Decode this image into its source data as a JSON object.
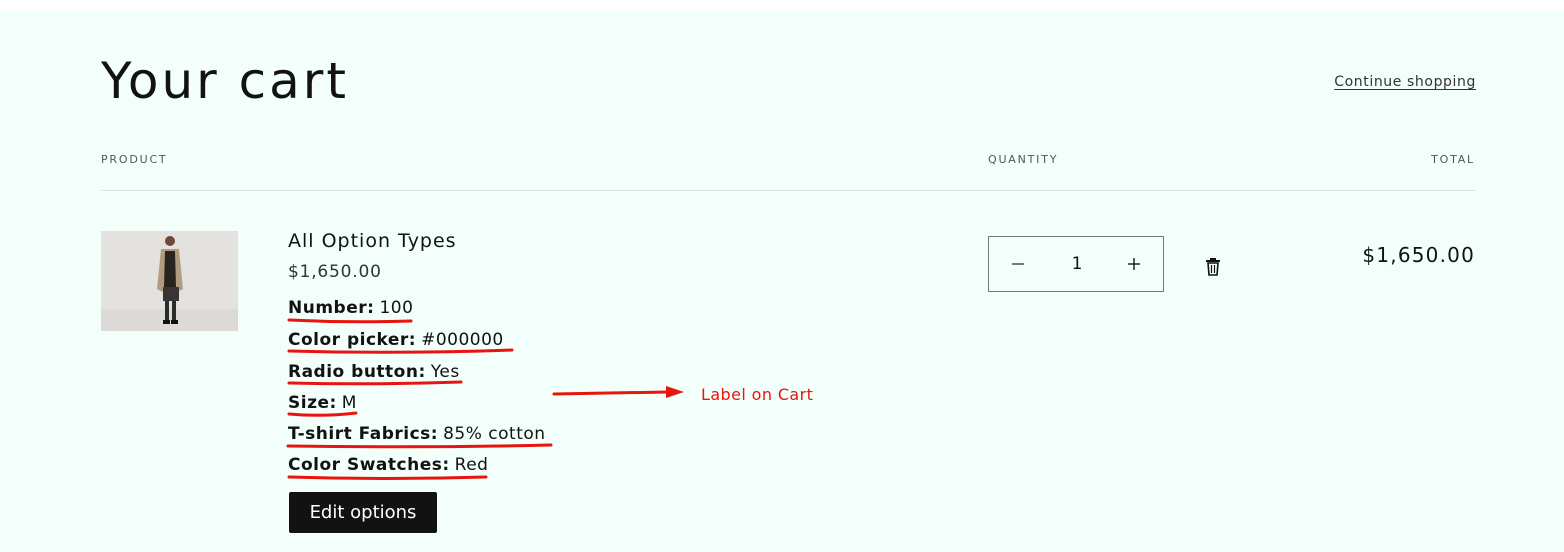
{
  "cart": {
    "title": "Your cart",
    "continue_shopping": "Continue shopping"
  },
  "columns": {
    "product": "PRODUCT",
    "quantity": "QUANTITY",
    "total": "TOTAL"
  },
  "item": {
    "name": "All Option Types",
    "price": "$1,650.00",
    "options": [
      {
        "label": "Number:",
        "value": "100"
      },
      {
        "label": "Color picker:",
        "value": "#000000"
      },
      {
        "label": "Radio button:",
        "value": "Yes"
      },
      {
        "label": "Size:",
        "value": "M"
      },
      {
        "label": "T-shirt Fabrics:",
        "value": "85% cotton"
      },
      {
        "label": "Color Swatches:",
        "value": "Red"
      }
    ],
    "edit_label": "Edit options",
    "quantity": "1",
    "line_total": "$1,650.00"
  },
  "annotation": {
    "text": "Label on Cart",
    "color": "#e8150f"
  },
  "icons": {
    "minus": "minus-icon",
    "plus": "plus-icon",
    "remove": "trash-icon"
  },
  "colors": {
    "page_background": "#f3fffa",
    "button_background": "#121212"
  }
}
